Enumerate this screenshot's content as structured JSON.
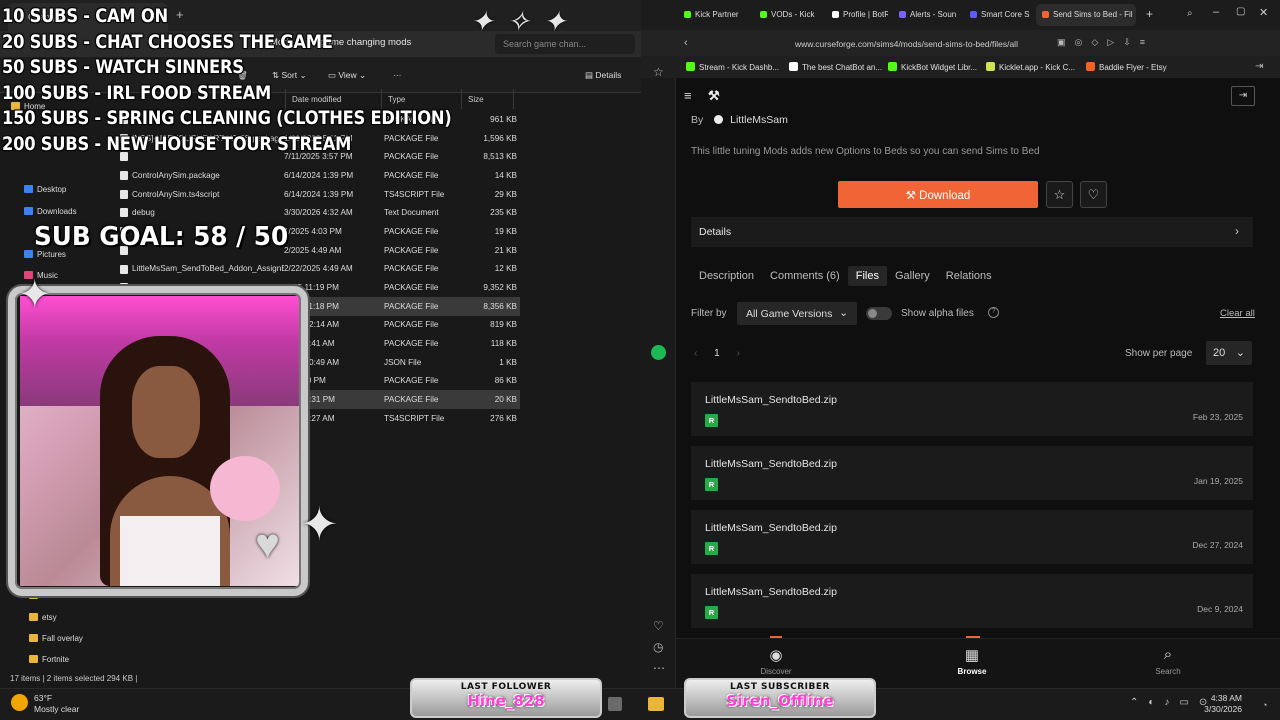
{
  "explorer": {
    "tab_title": "Changing",
    "breadcrumbs": [
      "Mods",
      "game changing mods"
    ],
    "search_placeholder": "Search game chan...",
    "toolbar": {
      "sort": "Sort",
      "view": "View",
      "more": "···",
      "details": "Details"
    },
    "columns": [
      "Date modified",
      "Type",
      "Size"
    ],
    "files": [
      {
        "name": "",
        "date": "",
        "type": "PACKAGE File",
        "size": "961 KB",
        "selected": false
      },
      {
        "name": "[NBS]-USEYOURHEART-V2-SS.package",
        "date": "1/23/2025 5:11 PM",
        "type": "PACKAGE File",
        "size": "1,596 KB",
        "selected": false
      },
      {
        "name": "",
        "date": "7/11/2025 3:57 PM",
        "type": "PACKAGE File",
        "size": "8,513 KB",
        "selected": false
      },
      {
        "name": "ControlAnySim.package",
        "date": "6/14/2024 1:39 PM",
        "type": "PACKAGE File",
        "size": "14 KB",
        "selected": false
      },
      {
        "name": "ControlAnySim.ts4script",
        "date": "6/14/2024 1:39 PM",
        "type": "TS4SCRIPT File",
        "size": "29 KB",
        "selected": false
      },
      {
        "name": "debug",
        "date": "3/30/2026 4:32 AM",
        "type": "Text Document",
        "size": "235 KB",
        "selected": false
      },
      {
        "name": "",
        "date": "1/2025 4:03 PM",
        "type": "PACKAGE File",
        "size": "19 KB",
        "selected": false
      },
      {
        "name": "",
        "date": "2/2025 4:49 AM",
        "type": "PACKAGE File",
        "size": "21 KB",
        "selected": false
      },
      {
        "name": "LittleMsSam_SendToBed_Addon_AssignB...",
        "date": "2/22/2025 4:49 AM",
        "type": "PACKAGE File",
        "size": "12 KB",
        "selected": false
      },
      {
        "name": "",
        "date": "2025 11:19 PM",
        "type": "PACKAGE File",
        "size": "9,352 KB",
        "selected": false
      },
      {
        "name": "",
        "date": "2025 11:18 PM",
        "type": "PACKAGE File",
        "size": "8,356 KB",
        "selected": true
      },
      {
        "name": "",
        "date": "2025 12:14 AM",
        "type": "PACKAGE File",
        "size": "819 KB",
        "selected": false
      },
      {
        "name": "",
        "date": "2025 3:41 AM",
        "type": "PACKAGE File",
        "size": "118 KB",
        "selected": false
      },
      {
        "name": "",
        "date": "2026 10:49 AM",
        "type": "JSON File",
        "size": "1 KB",
        "selected": false
      },
      {
        "name": "",
        "date": "24 4:20 PM",
        "type": "PACKAGE File",
        "size": "86 KB",
        "selected": false
      },
      {
        "name": "",
        "date": "2026 1:31 PM",
        "type": "PACKAGE File",
        "size": "20 KB",
        "selected": true
      },
      {
        "name": "",
        "date": "2026 7:27 AM",
        "type": "TS4SCRIPT File",
        "size": "276 KB",
        "selected": false
      }
    ],
    "nav_items": [
      "Home",
      "Desktop",
      "Downloads",
      "Pictures",
      "Music"
    ],
    "nav_folders": [
      "downloads Dri",
      "etsy",
      "Fall overlay",
      "Fortnite"
    ],
    "status": "17 items  |  2 items selected  294 KB  |"
  },
  "overlay": {
    "goals": [
      "10 SUBS - CAM ON",
      "20 SUBS - CHAT CHOOSES THE GAME",
      "50 SUBS - WATCH SINNERS",
      "100 SUBS - IRL FOOD STREAM",
      "150 SUBS - SPRING CLEANING (CLOTHES EDITION)",
      "200 SUBS - NEW HOUSE TOUR STREAM"
    ],
    "sub_goal": "SUB GOAL: 58 / 50",
    "last_follower_label": "LAST FOLLOWER",
    "last_follower_name": "Hine_828",
    "last_subscriber_label": "LAST SUBSCRIBER",
    "last_subscriber_name": "Siren_Offline"
  },
  "browser": {
    "tabs": [
      {
        "label": "Kick Partner",
        "color": "#53fc18"
      },
      {
        "label": "VODs - Kick",
        "color": "#53fc18"
      },
      {
        "label": "Profile | BotR",
        "color": "#ffffff"
      },
      {
        "label": "Alerts - Soun",
        "color": "#7b61ff"
      },
      {
        "label": "Smart Core S",
        "color": "#5b5bff"
      },
      {
        "label": "Send Sims to Bed - Fil",
        "color": "#f16436"
      }
    ],
    "url": "www.curseforge.com/sims4/mods/send-sims-to-bed/files/all",
    "bookmarks": [
      {
        "label": "Stream - Kick Dashb...",
        "color": "#53fc18"
      },
      {
        "label": "The best ChatBot an...",
        "color": "#ffffff"
      },
      {
        "label": "KickBot Widget Libr...",
        "color": "#53fc18"
      },
      {
        "label": "Kicklet.app - Kick C...",
        "color": "#cfe34a"
      },
      {
        "label": "Baddie Flyer - Etsy",
        "color": "#f1641e"
      }
    ]
  },
  "curseforge": {
    "by_label": "By",
    "author": "LittleMsSam",
    "description": "This little tuning Mods adds new Options to Beds so you can send Sims to Bed",
    "download_label": "Download",
    "details_label": "Details",
    "tabs": [
      "Description",
      "Comments (6)",
      "Files",
      "Gallery",
      "Relations"
    ],
    "active_tab": "Files",
    "filter_label": "Filter by",
    "filter_value": "All Game Versions",
    "alpha_label": "Show alpha files",
    "clear_all": "Clear all",
    "page": "1",
    "per_page_label": "Show per page",
    "per_page_value": "20",
    "files": [
      {
        "name": "LittleMsSam_SendtoBed.zip",
        "badge": "R",
        "date": "Feb 23, 2025"
      },
      {
        "name": "LittleMsSam_SendtoBed.zip",
        "badge": "R",
        "date": "Jan 19, 2025"
      },
      {
        "name": "LittleMsSam_SendtoBed.zip",
        "badge": "R",
        "date": "Dec 27, 2024"
      },
      {
        "name": "LittleMsSam_SendtoBed.zip",
        "badge": "R",
        "date": "Dec 9, 2024"
      }
    ],
    "bottom_nav": [
      "Discover",
      "Browse",
      "Search"
    ],
    "accent": "#f16436"
  },
  "taskbar": {
    "temp": "63°F",
    "condition": "Mostly clear",
    "time": "4:38 AM",
    "date": "3/30/2026"
  }
}
